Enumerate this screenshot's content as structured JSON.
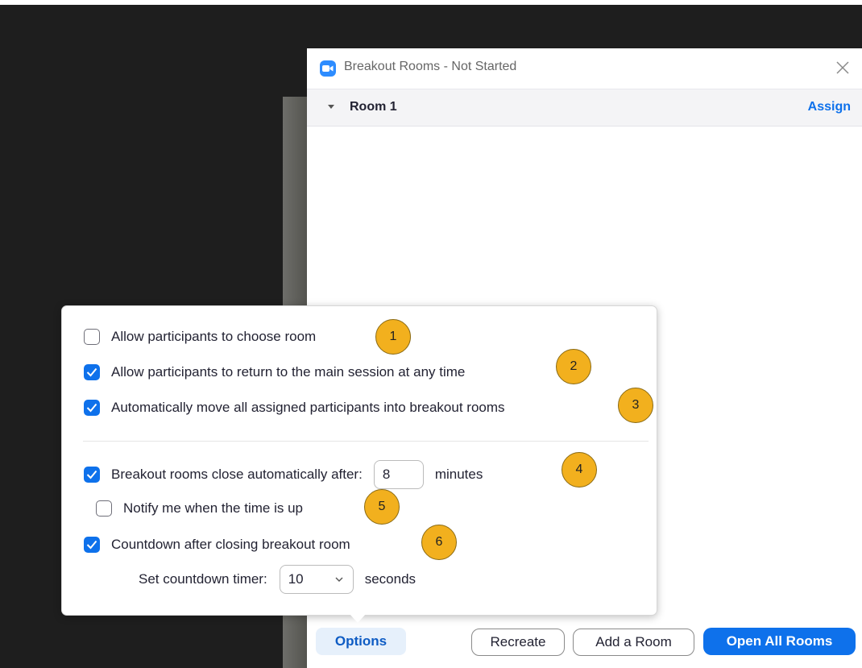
{
  "window": {
    "title": "Breakout Rooms - Not Started",
    "room_name": "Room 1",
    "assign_label": "Assign"
  },
  "buttons": {
    "options": "Options",
    "recreate": "Recreate",
    "add_room": "Add a Room",
    "open_all": "Open All Rooms"
  },
  "options": {
    "allow_choose": {
      "label": "Allow participants to choose room",
      "checked": false
    },
    "allow_return": {
      "label": "Allow participants to return to the main session at any time",
      "checked": true
    },
    "auto_move": {
      "label": "Automatically move all assigned participants into breakout rooms",
      "checked": true
    },
    "auto_close": {
      "label": "Breakout rooms close automatically after:",
      "checked": true,
      "value": "8",
      "unit": "minutes"
    },
    "notify": {
      "label": "Notify me when the time is up",
      "checked": false
    },
    "countdown": {
      "label": "Countdown after closing breakout room",
      "checked": true
    },
    "countdown_timer": {
      "label": "Set countdown timer:",
      "value": "10",
      "unit": "seconds"
    }
  },
  "badges": [
    "1",
    "2",
    "3",
    "4",
    "5",
    "6"
  ],
  "colors": {
    "accent": "#0e71eb",
    "badge": "#f2b01e",
    "background_dark": "#1e1e1e"
  }
}
